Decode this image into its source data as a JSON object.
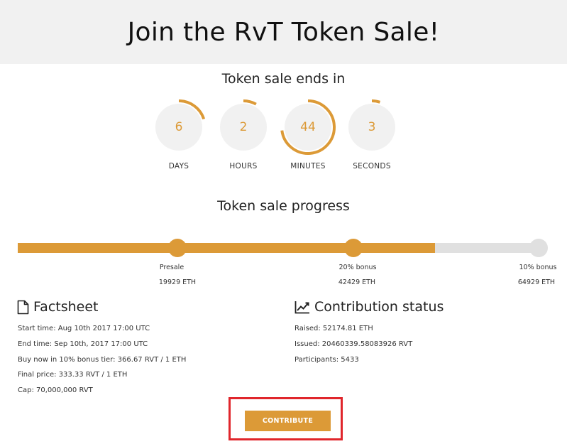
{
  "header": {
    "title": "Join the RvT Token Sale!"
  },
  "countdown": {
    "title": "Token sale ends in",
    "units": [
      {
        "value": "6",
        "label": "DAYS",
        "fraction": 0.2
      },
      {
        "value": "2",
        "label": "HOURS",
        "fraction": 0.08
      },
      {
        "value": "44",
        "label": "MINUTES",
        "fraction": 0.73
      },
      {
        "value": "3",
        "label": "SECONDS",
        "fraction": 0.05
      }
    ]
  },
  "progress": {
    "title": "Token sale progress",
    "fill_fraction": 0.8,
    "milestones": [
      {
        "name": "Presale",
        "amount": "19929 ETH",
        "reached": true
      },
      {
        "name": "20% bonus",
        "amount": "42429 ETH",
        "reached": true
      },
      {
        "name": "10% bonus",
        "amount": "64929 ETH",
        "reached": false
      }
    ]
  },
  "factsheet": {
    "title": "Factsheet",
    "lines": [
      "Start time: Aug 10th 2017 17:00 UTC",
      "End time: Sep 10th, 2017 17:00 UTC",
      "Buy now in 10% bonus tier: 366.67 RVT / 1 ETH",
      "Final price: 333.33 RVT / 1 ETH",
      "Cap: 70,000,000 RVT"
    ]
  },
  "contribution": {
    "title": "Contribution status",
    "lines": [
      "Raised: 52174.81 ETH",
      "Issued: 20460339.58083926 RVT",
      "Participants: 5433"
    ]
  },
  "cta": {
    "label": "CONTRIBUTE"
  },
  "colors": {
    "accent": "#dc9a37",
    "track": "#e0e0e0",
    "circle_bg": "#f1f1f1",
    "highlight": "#e0262c"
  }
}
